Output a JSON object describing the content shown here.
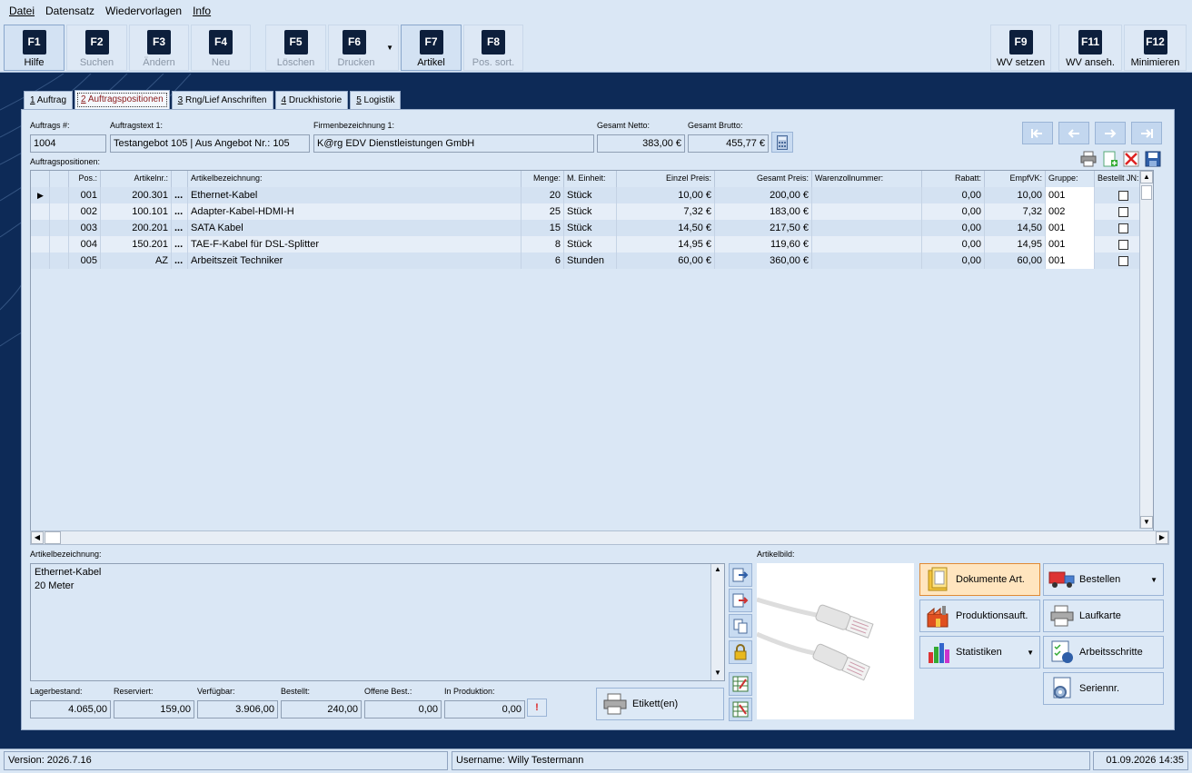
{
  "menu": {
    "datei": "Datei",
    "datensatz": "Datensatz",
    "wiedervorlagen": "Wiedervorlagen",
    "info": "Info"
  },
  "toolbar": [
    {
      "key": "F1",
      "label": "Hilfe",
      "enabled": true
    },
    {
      "key": "F2",
      "label": "Suchen",
      "enabled": false
    },
    {
      "key": "F3",
      "label": "Ändern",
      "enabled": false
    },
    {
      "key": "F4",
      "label": "Neu",
      "enabled": false
    },
    {
      "key": "F5",
      "label": "Löschen",
      "enabled": false
    },
    {
      "key": "F6",
      "label": "Drucken",
      "enabled": false
    },
    {
      "key": "F7",
      "label": "Artikel",
      "enabled": true
    },
    {
      "key": "F8",
      "label": "Pos. sort.",
      "enabled": false
    },
    {
      "key": "F9",
      "label": "WV setzen",
      "enabled": true
    },
    {
      "key": "F11",
      "label": "WV anseh.",
      "enabled": true
    },
    {
      "key": "F12",
      "label": "Minimieren",
      "enabled": true
    }
  ],
  "tabs": [
    {
      "num": "1",
      "label": " Auftrag"
    },
    {
      "num": "2",
      "label": " Auftragspositionen"
    },
    {
      "num": "3",
      "label": " Rng/Lief Anschriften"
    },
    {
      "num": "4",
      "label": " Druckhistorie"
    },
    {
      "num": "5",
      "label": " Logistik"
    }
  ],
  "header": {
    "auftrag_label": "Auftrags #:",
    "auftrag_value": "1004",
    "text_label": "Auftragstext 1:",
    "text_value": "Testangebot 105 | Aus Angebot Nr.: 105",
    "firma_label": "Firmenbezeichnung 1:",
    "firma_value": "K@rg EDV Dienstleistungen GmbH",
    "netto_label": "Gesamt Netto:",
    "netto_value": "383,00 €",
    "brutto_label": "Gesamt Brutto:",
    "brutto_value": "455,77 €"
  },
  "grid": {
    "title": "Auftragspositionen:",
    "columns": [
      "Pos.:",
      "Artikelnr.:",
      "Artikelbezeichnung:",
      "Menge:",
      "M. Einheit:",
      "Einzel Preis:",
      "Gesamt Preis:",
      "Warenzollnummer:",
      "Rabatt:",
      "EmpfVK:",
      "Gruppe:",
      "Bestellt JN:"
    ],
    "rows": [
      {
        "pos": "001",
        "artnr": "200.301",
        "bez": "Ethernet-Kabel",
        "menge": "20",
        "einheit": "Stück",
        "einzel": "10,00 €",
        "gesamt": "200,00 €",
        "zoll": "",
        "rabatt": "0,00",
        "empf": "10,00",
        "gruppe": "001",
        "bestellt": false
      },
      {
        "pos": "002",
        "artnr": "100.101",
        "bez": "Adapter-Kabel-HDMI-H",
        "menge": "25",
        "einheit": "Stück",
        "einzel": "7,32 €",
        "gesamt": "183,00 €",
        "zoll": "",
        "rabatt": "0,00",
        "empf": "7,32",
        "gruppe": "002",
        "bestellt": false
      },
      {
        "pos": "003",
        "artnr": "200.201",
        "bez": "SATA Kabel",
        "menge": "15",
        "einheit": "Stück",
        "einzel": "14,50 €",
        "gesamt": "217,50 €",
        "zoll": "",
        "rabatt": "0,00",
        "empf": "14,50",
        "gruppe": "001",
        "bestellt": false
      },
      {
        "pos": "004",
        "artnr": "150.201",
        "bez": "TAE-F-Kabel für DSL-Splitter",
        "menge": "8",
        "einheit": "Stück",
        "einzel": "14,95 €",
        "gesamt": "119,60 €",
        "zoll": "",
        "rabatt": "0,00",
        "empf": "14,95",
        "gruppe": "001",
        "bestellt": false
      },
      {
        "pos": "005",
        "artnr": "AZ",
        "bez": "Arbeitszeit Techniker",
        "menge": "6",
        "einheit": "Stunden",
        "einzel": "60,00 €",
        "gesamt": "360,00 €",
        "zoll": "",
        "rabatt": "0,00",
        "empf": "60,00",
        "gruppe": "001",
        "bestellt": false
      }
    ],
    "ellipsis": "..."
  },
  "detail": {
    "bez_label": "Artikelbezeichnung:",
    "bez_line1": "Ethernet-Kabel",
    "bez_line2": "20 Meter",
    "bild_label": "Artikelbild:"
  },
  "stock": [
    {
      "label": "Lagerbestand:",
      "value": "4.065,00"
    },
    {
      "label": "Reserviert:",
      "value": "159,00"
    },
    {
      "label": "Verfügbar:",
      "value": "3.906,00"
    },
    {
      "label": "Bestellt:",
      "value": "240,00"
    },
    {
      "label": "Offene Best.:",
      "value": "0,00"
    },
    {
      "label": "In Produktion:",
      "value": "0,00"
    }
  ],
  "etikett_label": "Etikett(en)",
  "actions": {
    "dokumente": "Dokumente Art.",
    "bestellen": "Bestellen",
    "produktion": "Produktionsauft.",
    "laufkarte": "Laufkarte",
    "statistiken": "Statistiken",
    "arbeitsschritte": "Arbeitsschritte",
    "seriennr": "Seriennr."
  },
  "status": {
    "version": "Version: 2026.7.16",
    "user": "Username: Willy Testermann",
    "datetime": "01.09.2026 14:35"
  }
}
